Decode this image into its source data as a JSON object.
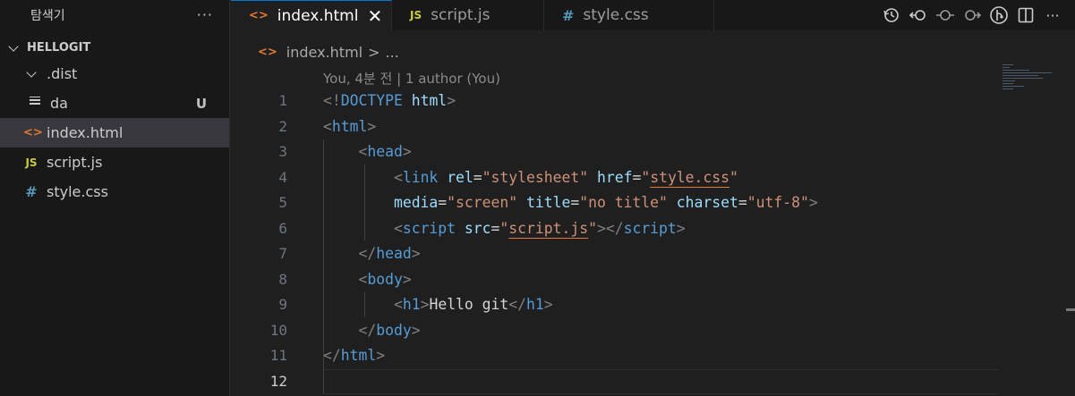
{
  "sidebar": {
    "title": "탐색기",
    "more": "···",
    "section": "HELLOGIT",
    "items": [
      {
        "label": ".dist",
        "icon": "chevron-down-icon",
        "badge": ""
      },
      {
        "label": "da",
        "icon": "lines-file-icon",
        "badge": "U"
      },
      {
        "label": "index.html",
        "icon": "html-icon",
        "icon_text": "<>",
        "badge": ""
      },
      {
        "label": "script.js",
        "icon": "js-icon",
        "icon_text": "JS",
        "badge": ""
      },
      {
        "label": "style.css",
        "icon": "css-icon",
        "icon_text": "#",
        "badge": ""
      }
    ]
  },
  "tabs": [
    {
      "label": "index.html",
      "icon_text": "<>",
      "close": "✕"
    },
    {
      "label": "script.js",
      "icon_text": "JS"
    },
    {
      "label": "style.css",
      "icon_text": "#"
    }
  ],
  "breadcrumb": {
    "icon_text": "<>",
    "file": "index.html",
    "sep": ">",
    "rest": "..."
  },
  "codelens": "You, 4분 전 | 1 author (You)",
  "line_numbers": [
    "1",
    "2",
    "3",
    "4",
    "5",
    "6",
    "7",
    "8",
    "9",
    "10",
    "11",
    "12"
  ],
  "colors": {
    "accent": "#0078d4",
    "tag": "#569cd6",
    "attr": "#9cdcfe",
    "string": "#ce9178",
    "html_icon": "#e37933",
    "js_icon": "#cbcb41",
    "css_icon": "#519aba"
  }
}
